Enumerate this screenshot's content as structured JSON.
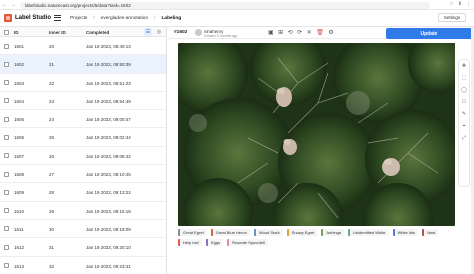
{
  "browser": {
    "url": "labelstudio.naturecast.org/projects/5/data?task=1602",
    "back_glyph": "←",
    "forward_glyph": "→",
    "reload_glyph": "↻",
    "icons": [
      "☆",
      "⬇",
      "⋮"
    ]
  },
  "header": {
    "title": "Label Studio",
    "breadcrumbs": [
      "Projects",
      "everglades-annotation",
      "Labeling"
    ],
    "crumb_separator": "/",
    "settings_label": "Settings",
    "brand_color": "#e8563a"
  },
  "table": {
    "columns": {
      "id": "ID",
      "inner_id": "Inner ID",
      "completed": "Completed"
    },
    "rows": [
      {
        "id": "1601",
        "inner": "20",
        "completed": "Jan 19 2023, 08:49:13",
        "selected": false
      },
      {
        "id": "1602",
        "inner": "21",
        "completed": "Jan 19 2023, 08:50:39",
        "selected": true
      },
      {
        "id": "1603",
        "inner": "22",
        "completed": "Jan 19 2023, 08:51:23",
        "selected": false
      },
      {
        "id": "1604",
        "inner": "23",
        "completed": "Jan 19 2023, 08:54:49",
        "selected": false
      },
      {
        "id": "1605",
        "inner": "24",
        "completed": "Jan 19 2023, 09:00:47",
        "selected": false
      },
      {
        "id": "1606",
        "inner": "25",
        "completed": "Jan 19 2023, 09:02:44",
        "selected": false
      },
      {
        "id": "1607",
        "inner": "26",
        "completed": "Jan 19 2023, 09:08:42",
        "selected": false
      },
      {
        "id": "1608",
        "inner": "27",
        "completed": "Jan 19 2023, 09:10:45",
        "selected": false
      },
      {
        "id": "1609",
        "inner": "28",
        "completed": "Jan 19 2023, 09:13:22",
        "selected": false
      },
      {
        "id": "1610",
        "inner": "29",
        "completed": "Jan 19 2023, 09:15:18",
        "selected": false
      },
      {
        "id": "1611",
        "inner": "30",
        "completed": "Jan 19 2023, 09:18:09",
        "selected": false
      },
      {
        "id": "1612",
        "inner": "31",
        "completed": "Jan 19 2023, 09:20:10",
        "selected": false
      },
      {
        "id": "1613",
        "inner": "32",
        "completed": "Jan 19 2023, 09:23:41",
        "selected": false
      }
    ],
    "tools": [
      "☰",
      "◎"
    ]
  },
  "annotation": {
    "task_id": "#1602",
    "user_name": "ninahenry",
    "user_time": "Created 17 months ago",
    "update_label": "Update",
    "accent": "#2f7bea",
    "toolbar_icons": [
      "▣",
      "⊞",
      "⟲",
      "⟳",
      "✕",
      "🗑",
      "⚙"
    ],
    "side_tools": [
      "✥",
      "⬚",
      "◯",
      "⬠",
      "✎",
      "⌖",
      "⤢"
    ]
  },
  "labels": [
    {
      "name": "Great Egret",
      "color": "#8c8c8c"
    },
    {
      "name": "Great Blue Heron",
      "color": "#c26b40"
    },
    {
      "name": "Wood Stork",
      "color": "#6b8fc7"
    },
    {
      "name": "Snowy Egret",
      "color": "#d7a33a"
    },
    {
      "name": "Anhinga",
      "color": "#7aa35a"
    },
    {
      "name": "Unidentified White",
      "color": "#5fb07d"
    },
    {
      "name": "White Ibis",
      "color": "#5a7fd1"
    },
    {
      "name": "Nest",
      "color": "#b4524f"
    },
    {
      "name": "Help me!",
      "color": "#e35b4f"
    },
    {
      "name": "Eggs",
      "color": "#8e6fbf"
    },
    {
      "name": "Roseate Spoonbill",
      "color": "#e38aa7"
    }
  ]
}
